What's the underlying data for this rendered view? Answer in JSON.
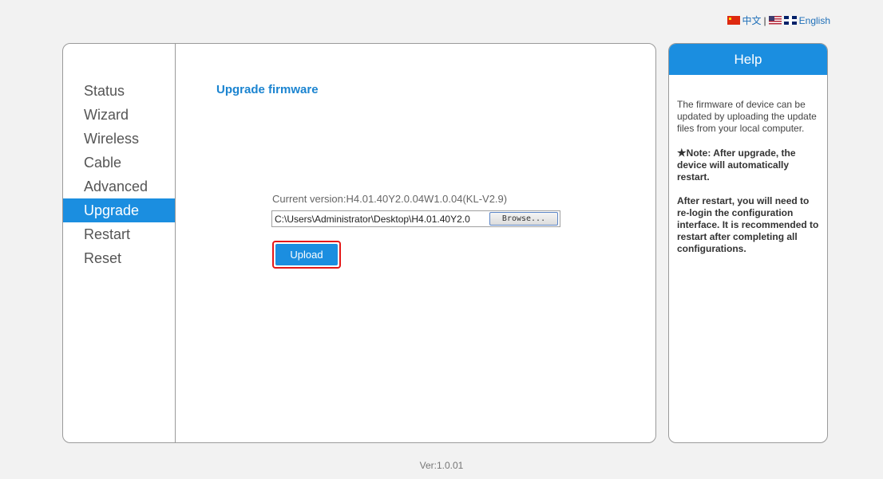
{
  "language": {
    "chinese_label": "中文",
    "separator": "|",
    "english_label": "English"
  },
  "sidebar": {
    "items": [
      {
        "label": "Status"
      },
      {
        "label": "Wizard"
      },
      {
        "label": "Wireless"
      },
      {
        "label": "Cable"
      },
      {
        "label": "Advanced"
      },
      {
        "label": "Upgrade",
        "active": true
      },
      {
        "label": "Restart"
      },
      {
        "label": "Reset"
      }
    ]
  },
  "main": {
    "title": "Upgrade firmware",
    "current_version": "Current version:H4.01.40Y2.0.04W1.0.04(KL-V2.9)",
    "file_path": "C:\\Users\\Administrator\\Desktop\\H4.01.40Y2.0",
    "browse_label": "Browse...",
    "upload_label": "Upload"
  },
  "help": {
    "title": "Help",
    "paragraph1": "The firmware of device can be updated by uploading the update files from your local computer.",
    "note_star": "★",
    "note": "Note: After upgrade, the device will automatically restart.",
    "paragraph3": "After restart, you will need to re-login the configuration interface. It is recommended to restart after completing all configurations."
  },
  "footer": {
    "version": "Ver:1.0.01"
  },
  "colors": {
    "accent": "#1b8ee0",
    "highlight_border": "#e51818"
  }
}
